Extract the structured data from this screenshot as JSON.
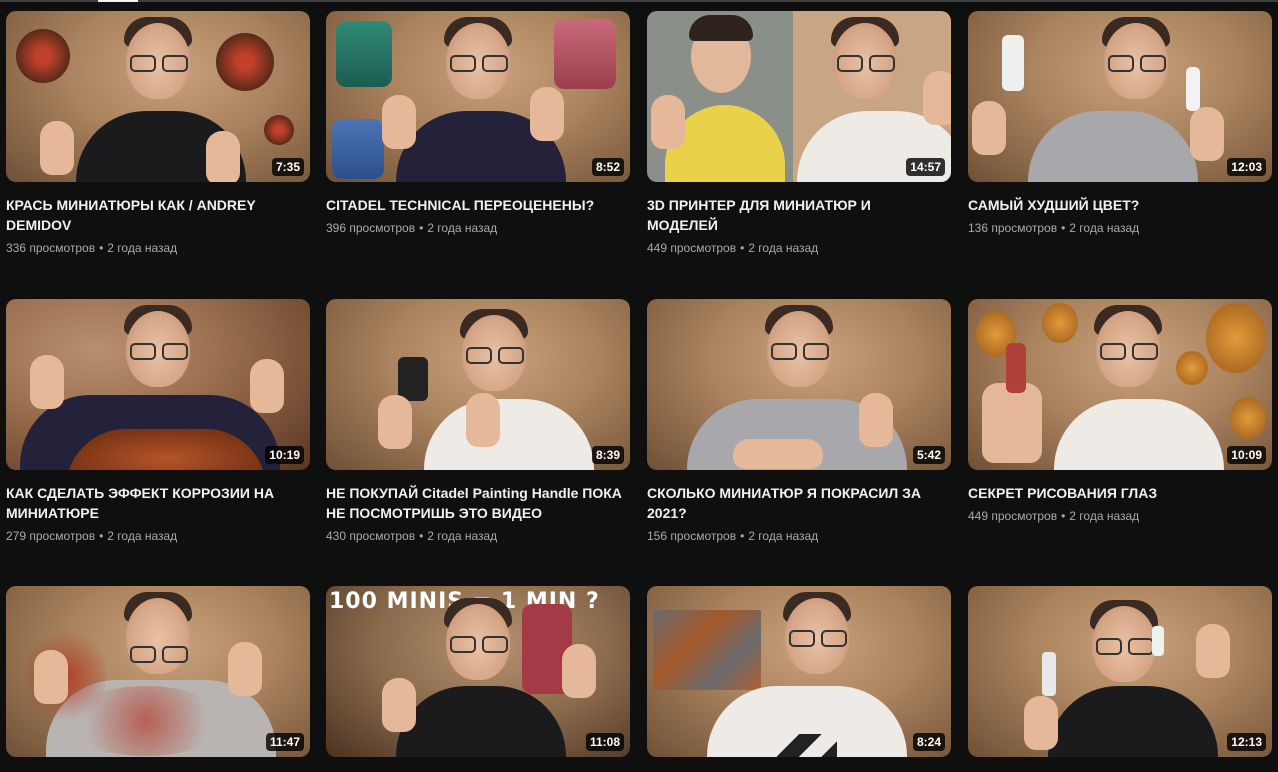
{
  "videos": [
    {
      "title": "КРАСЬ МИНИАТЮРЫ КАК / ANDREY DEMIDOV",
      "views": "336 просмотров",
      "age": "2 года назад",
      "duration": "7:35"
    },
    {
      "title": "CITADEL TECHNICAL ПЕРЕОЦЕНЕНЫ?",
      "views": "396 просмотров",
      "age": "2 года назад",
      "duration": "8:52"
    },
    {
      "title": "3D ПРИНТЕР ДЛЯ МИНИАТЮР И МОДЕЛЕЙ",
      "views": "449 просмотров",
      "age": "2 года назад",
      "duration": "14:57"
    },
    {
      "title": "САМЫЙ ХУДШИЙ ЦВЕТ?",
      "views": "136 просмотров",
      "age": "2 года назад",
      "duration": "12:03"
    },
    {
      "title": "КАК СДЕЛАТЬ ЭФФЕКТ КОРРОЗИИ НА МИНИАТЮРЕ",
      "views": "279 просмотров",
      "age": "2 года назад",
      "duration": "10:19"
    },
    {
      "title": "НЕ ПОКУПАЙ Citadel Painting Handle ПОКА НЕ ПОСМОТРИШЬ ЭТО ВИДЕО",
      "views": "430 просмотров",
      "age": "2 года назад",
      "duration": "8:39"
    },
    {
      "title": "СКОЛЬКО МИНИАТЮР Я ПОКРАСИЛ ЗА 2021?",
      "views": "156 просмотров",
      "age": "2 года назад",
      "duration": "5:42"
    },
    {
      "title": "СЕКРЕТ РИСОВАНИЯ ГЛАЗ",
      "views": "449 просмотров",
      "age": "2 года назад",
      "duration": "10:09"
    },
    {
      "title": "",
      "views": "",
      "age": "",
      "duration": "11:47"
    },
    {
      "title": "",
      "views": "",
      "age": "",
      "duration": "11:08",
      "thumb_text": "100 MINIS = 1 MIN ?"
    },
    {
      "title": "",
      "views": "",
      "age": "",
      "duration": "8:24"
    },
    {
      "title": "",
      "views": "",
      "age": "",
      "duration": "12:13"
    }
  ]
}
